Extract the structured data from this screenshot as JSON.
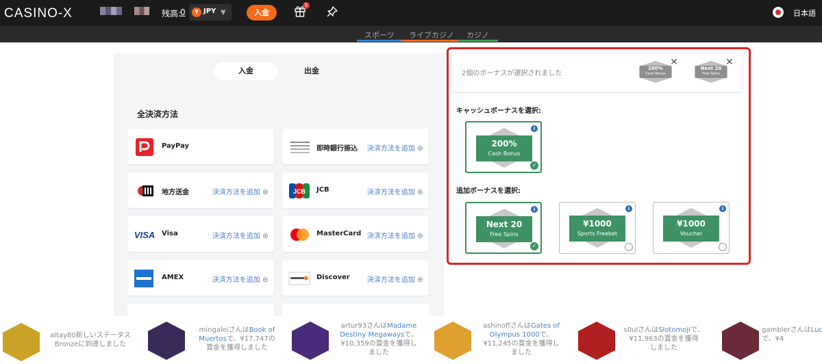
{
  "header": {
    "logo": "CASINO-X",
    "balance_label": "残高:",
    "balance_value": "0",
    "currency_code": "JPY",
    "currency_icon_letter": "Y",
    "deposit_button": "入金",
    "gift_badge": "5",
    "language": "日本語"
  },
  "subnav": {
    "tabs": [
      {
        "label": "スポーツ",
        "color": "#2d7fd6"
      },
      {
        "label": "ライブカジノ",
        "color": "#f26b1d"
      },
      {
        "label": "カジノ",
        "color": "#3ea055"
      }
    ]
  },
  "payment": {
    "toggle_deposit": "入金",
    "toggle_withdraw": "出金",
    "section_title": "全決済方法",
    "add_label": "決済方法を追加",
    "methods": [
      {
        "name": "PayPay",
        "logo": "paypay-logo",
        "has_add": false
      },
      {
        "name": "即時銀行振込",
        "logo": "bank-transfer-icon",
        "has_add": true
      },
      {
        "name": "地方送金",
        "logo": "local-remittance-icon",
        "has_add": true
      },
      {
        "name": "JCB",
        "logo": "jcb-logo",
        "has_add": true
      },
      {
        "name": "Visa",
        "logo": "visa-logo",
        "has_add": true
      },
      {
        "name": "MasterCard",
        "logo": "mastercard-logo",
        "has_add": true
      },
      {
        "name": "AMEX",
        "logo": "amex-logo",
        "has_add": true
      },
      {
        "name": "Discover",
        "logo": "discover-logo",
        "has_add": true
      }
    ]
  },
  "bonus": {
    "selected_text": "2個のボーナスが選択されました",
    "selected_chips": [
      {
        "line1": "200%",
        "line2": "Cash Bonus"
      },
      {
        "line1": "Next 20",
        "line2": "Free Spins"
      }
    ],
    "cash_heading": "キャッシュボーナスを選択:",
    "cash_options": [
      {
        "line1": "200%",
        "line2": "Cash Bonus",
        "selected": true
      }
    ],
    "extra_heading": "追加ボーナスを選択:",
    "extra_options": [
      {
        "line1": "Next 20",
        "line2": "Free Spins",
        "selected": true
      },
      {
        "line1": "¥1000",
        "line2": "Sports Freebet",
        "selected": false
      },
      {
        "line1": "¥1000",
        "line2": "Voucher",
        "selected": false
      }
    ],
    "highlight_color": "#d92626",
    "accent_green": "#3e9263"
  },
  "ticker": [
    {
      "parts": [
        "altay80新しいステータス",
        "Bronzeに到達しました"
      ],
      "game": "",
      "color": "#c9a227"
    },
    {
      "parts": [
        "mingaleiさんは",
        "で、¥17,747の",
        "賞金を獲得しました"
      ],
      "game": "Book of Muertos",
      "color": "#3a2a5a"
    },
    {
      "parts": [
        "artur93さんは",
        "で、",
        "¥10,359の賞金を獲得し",
        "ました"
      ],
      "game": "Madame Destiny Megaways",
      "color": "#4a2a7a"
    },
    {
      "parts": [
        "ashinoffさんは",
        "で、",
        "¥11,245の賞金を獲得し",
        "ました"
      ],
      "game": "Gates of Olympus 1000",
      "color": "#e0a030"
    },
    {
      "parts": [
        "s0ulさんは",
        "で、",
        "¥11,963の賞金を獲得",
        "しました"
      ],
      "game": "Slotomoji",
      "color": "#b02020"
    },
    {
      "parts": [
        "gamblerさんは",
        "で、¥4"
      ],
      "game": "Lucky Baccarat",
      "color": "#6a2a3a"
    }
  ]
}
